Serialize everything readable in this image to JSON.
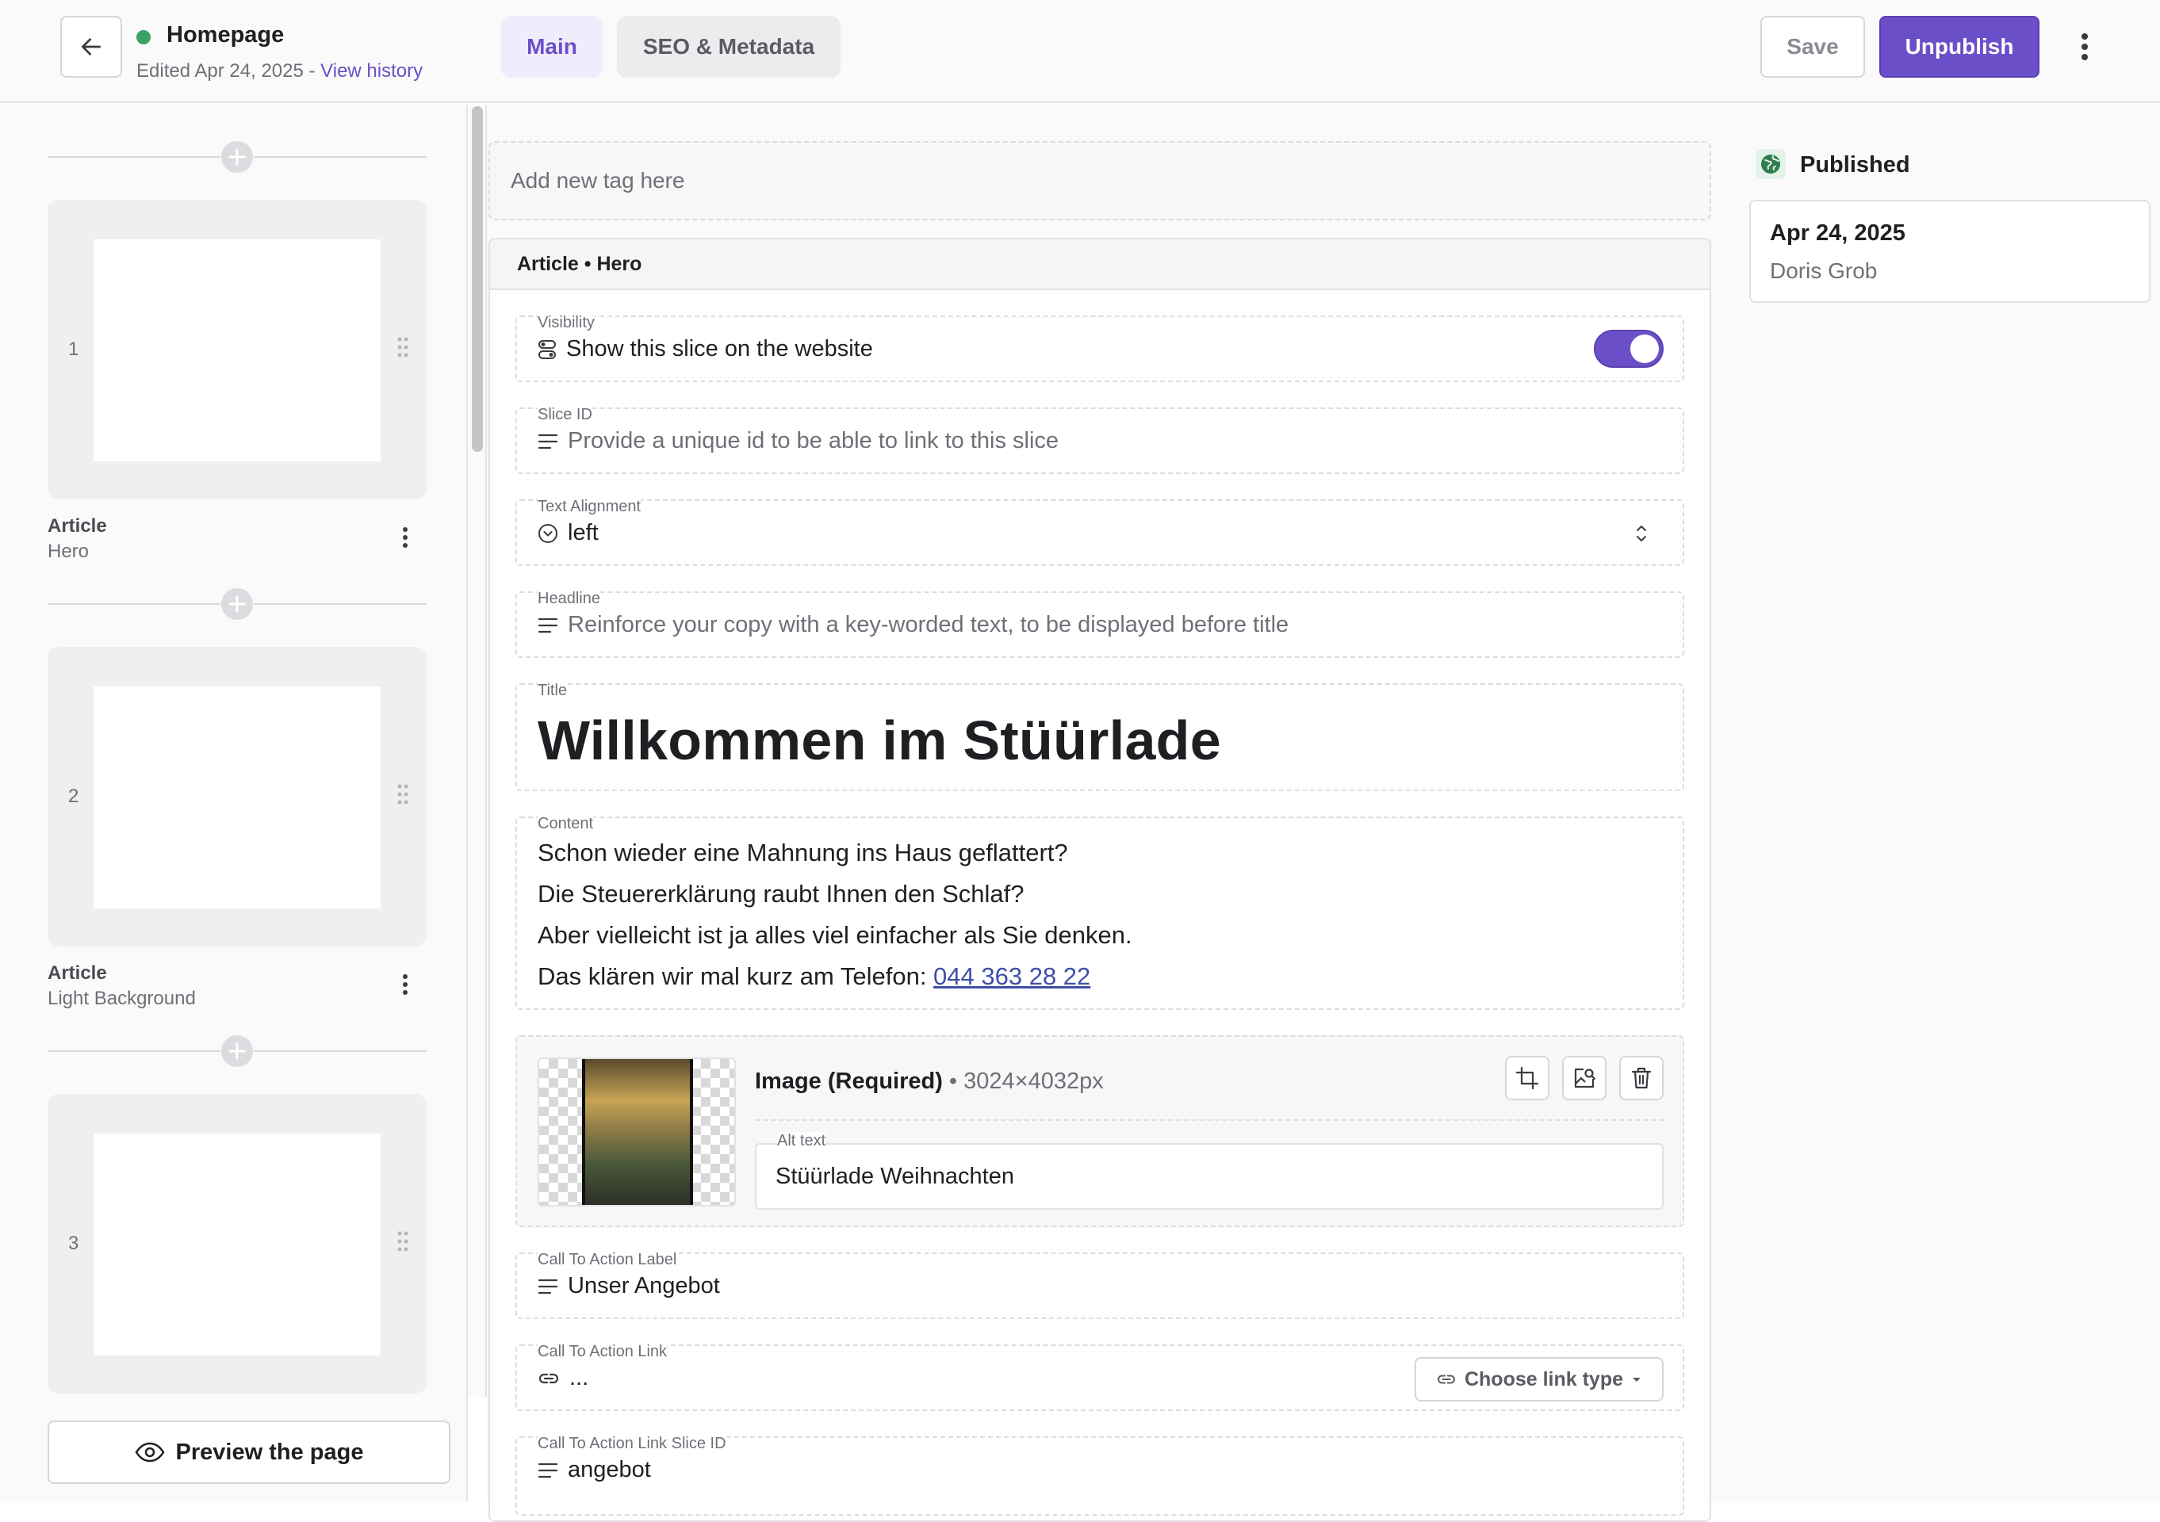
{
  "header": {
    "document_title": "Homepage",
    "edited_text": "Edited Apr 24, 2025 - ",
    "view_history_label": "View history",
    "tabs": [
      {
        "label": "Main",
        "active": true
      },
      {
        "label": "SEO & Metadata",
        "active": false
      }
    ],
    "save_label": "Save",
    "unpublish_label": "Unpublish"
  },
  "sidebar": {
    "slices": [
      {
        "number": "1",
        "name": "Article",
        "variant": "Hero"
      },
      {
        "number": "2",
        "name": "Article",
        "variant": "Light Background"
      },
      {
        "number": "3",
        "name": "",
        "variant": ""
      }
    ],
    "preview_label": "Preview the page"
  },
  "editor": {
    "tag_placeholder": "Add new tag here",
    "slice_header": "Article • Hero",
    "fields": {
      "visibility": {
        "label": "Visibility",
        "text": "Show this slice on the website",
        "on": true
      },
      "slice_id": {
        "label": "Slice ID",
        "placeholder": "Provide a unique id to be able to link to this slice"
      },
      "text_alignment": {
        "label": "Text Alignment",
        "value": "left"
      },
      "headline": {
        "label": "Headline",
        "placeholder": "Reinforce your copy with a key-worded text, to be displayed before title"
      },
      "title": {
        "label": "Title",
        "value": "Willkommen im Stüürlade"
      },
      "content": {
        "label": "Content",
        "lines": [
          "Schon wieder eine Mahnung ins Haus geflattert?",
          "Die Steuererklärung raubt Ihnen den Schlaf?",
          "Aber vielleicht ist ja alles viel einfacher als Sie denken."
        ],
        "last_line_prefix": "Das klären wir mal kurz am Telefon: ",
        "phone": "044 363 28 22"
      },
      "image": {
        "title": "Image (Required)",
        "separator": " • ",
        "dimensions": "3024×4032px",
        "alt_label": "Alt text",
        "alt_value": "Stüürlade Weihnachten"
      },
      "cta_label": {
        "label": "Call To Action Label",
        "value": "Unser Angebot"
      },
      "cta_link": {
        "label": "Call To Action Link",
        "value": "...",
        "button": "Choose link type"
      },
      "cta_slice_id": {
        "label": "Call To Action Link Slice ID",
        "value": "angebot"
      }
    }
  },
  "status_panel": {
    "label": "Published",
    "date": "Apr 24, 2025",
    "user": "Doris Grob"
  },
  "colors": {
    "accent": "#6b4fc8",
    "published_green": "#3aa067",
    "link_blue": "#3d4fa8"
  }
}
